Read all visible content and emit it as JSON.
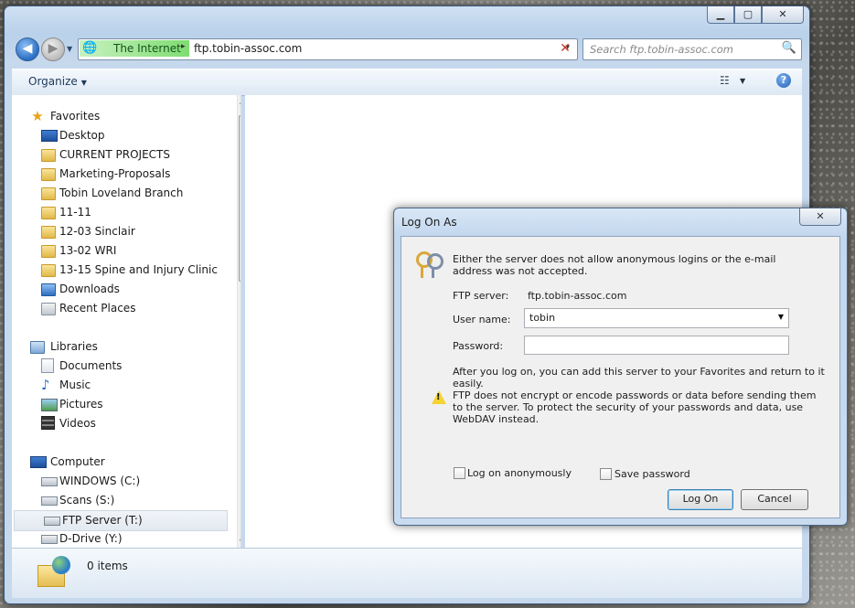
{
  "window": {
    "buttons": {
      "minimize": "▁",
      "maximize": "▢",
      "close": "✕"
    }
  },
  "address": {
    "segments": [
      "The Internet",
      "ftp.tobin-assoc.com"
    ],
    "separator": "▸",
    "dropdown": "▾",
    "stop": "✕"
  },
  "search": {
    "placeholder": "Search ftp.tobin-assoc.com",
    "icon": "🔍"
  },
  "toolbar": {
    "organize": "Organize",
    "help": "?",
    "view_icon": "☷"
  },
  "nav": {
    "favorites": {
      "label": "Favorites",
      "items": [
        "Desktop",
        "CURRENT PROJECTS",
        "Marketing-Proposals",
        "Tobin Loveland Branch",
        "11-11",
        "12-03 Sinclair",
        "13-02 WRI",
        "13-15 Spine and Injury Clinic",
        "Downloads",
        "Recent Places"
      ]
    },
    "libraries": {
      "label": "Libraries",
      "items": [
        "Documents",
        "Music",
        "Pictures",
        "Videos"
      ]
    },
    "computer": {
      "label": "Computer",
      "items": [
        "WINDOWS (C:)",
        "Scans (S:)",
        "FTP Server (T:)",
        "D-Drive (Y:)"
      ]
    }
  },
  "status": {
    "items": "0 items"
  },
  "dialog": {
    "title": "Log On As",
    "close": "✕",
    "message": "Either the server does not allow anonymous logins or the e-mail address was not accepted.",
    "ftp_server_label": "FTP server:",
    "ftp_server_value": "ftp.tobin-assoc.com",
    "username_label": "User name:",
    "username_value": "tobin",
    "password_label": "Password:",
    "after_logon": "After you log on, you can add this server to your Favorites and return to it easily.",
    "warning": "FTP does not encrypt or encode passwords or data before sending them to the server.  To protect the security of your passwords and data, use WebDAV instead.",
    "anonymous_label": "Log on anonymously",
    "save_password_label": "Save password",
    "logon_button": "Log On",
    "cancel_button": "Cancel"
  }
}
